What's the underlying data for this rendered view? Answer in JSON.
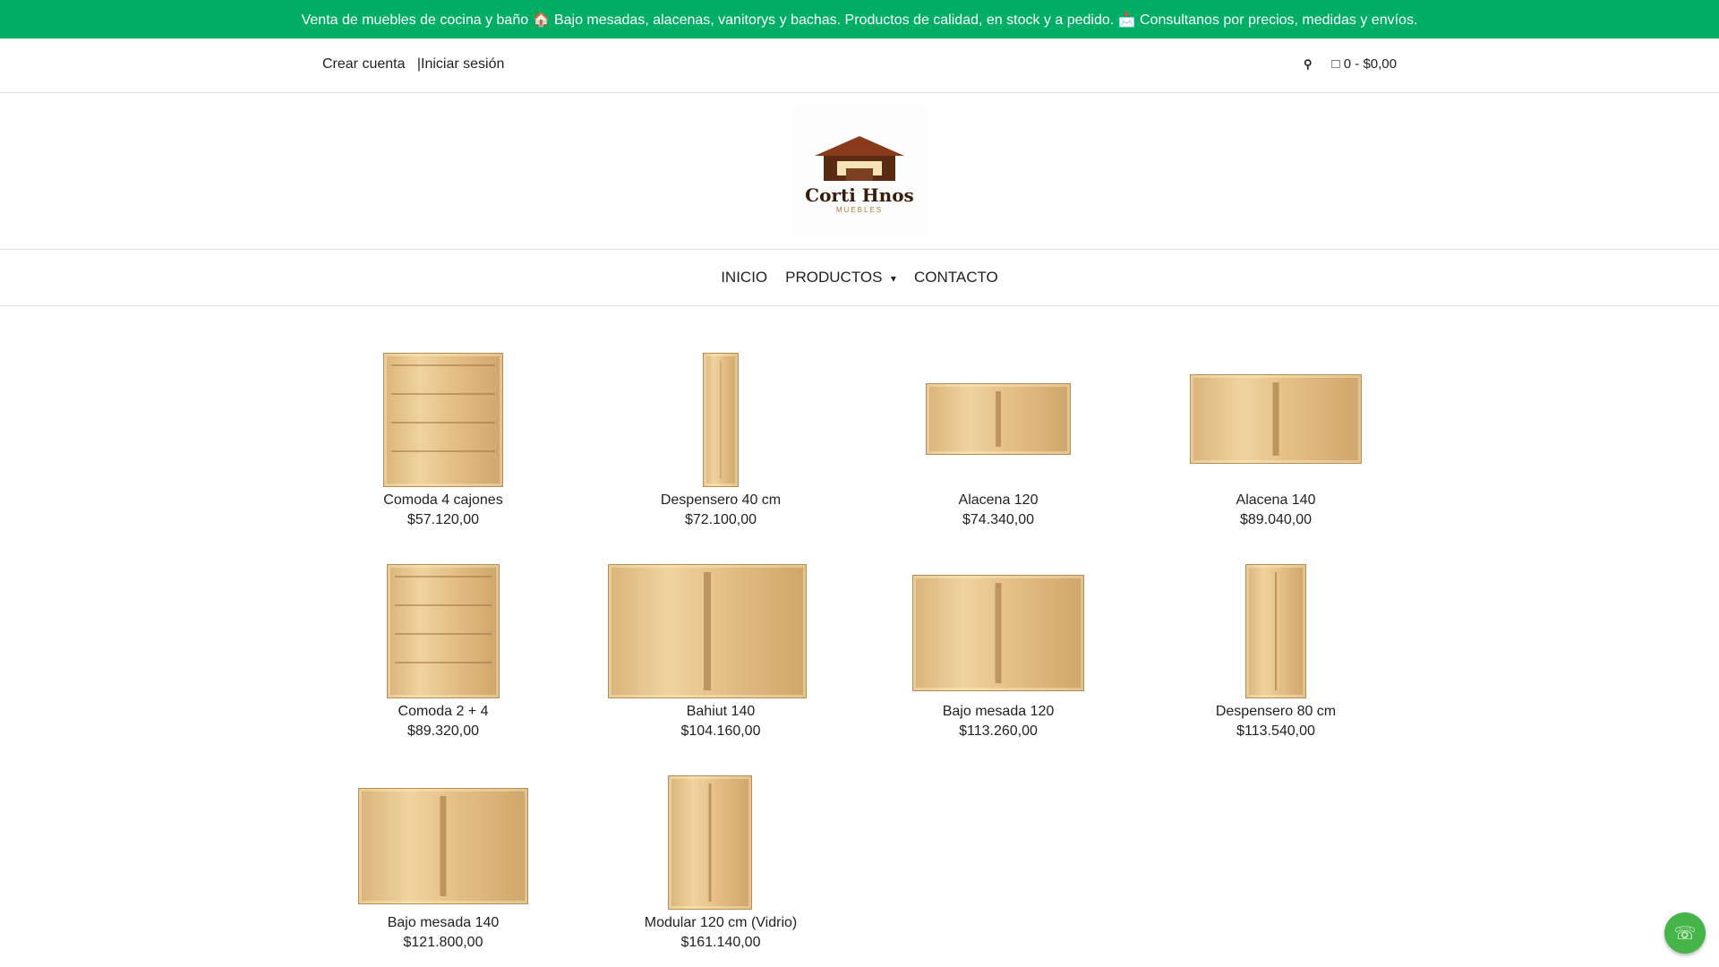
{
  "announcement": "Venta de muebles de cocina y baño 🏠 Bajo mesadas, alacenas, vanitorys y bachas. Productos de calidad, en stock y a pedido. 📩 Consultanos por precios, medidas y envíos.",
  "account": {
    "create": "Crear cuenta",
    "separator": "|",
    "login": "Iniciar sesión"
  },
  "cart": {
    "label": "0 - $0,00"
  },
  "logo": {
    "title": "Corti Hnos",
    "subtitle": "MUEBLES"
  },
  "nav": {
    "inicio": "INICIO",
    "productos": "PRODUCTOS",
    "contacto": "CONTACTO"
  },
  "products": [
    {
      "name": "Comoda 4 cajones",
      "price": "$57.120,00"
    },
    {
      "name": "Despensero 40 cm",
      "price": "$72.100,00"
    },
    {
      "name": "Alacena 120",
      "price": "$74.340,00"
    },
    {
      "name": "Alacena 140",
      "price": "$89.040,00"
    },
    {
      "name": "Comoda 2 + 4",
      "price": "$89.320,00"
    },
    {
      "name": "Bahiut 140",
      "price": "$104.160,00"
    },
    {
      "name": "Bajo mesada 120",
      "price": "$113.260,00"
    },
    {
      "name": "Despensero 80 cm",
      "price": "$113.540,00"
    },
    {
      "name": "Bajo mesada 140",
      "price": "$121.800,00"
    },
    {
      "name": "Modular 120 cm (Vidrio)",
      "price": "$161.140,00"
    }
  ]
}
